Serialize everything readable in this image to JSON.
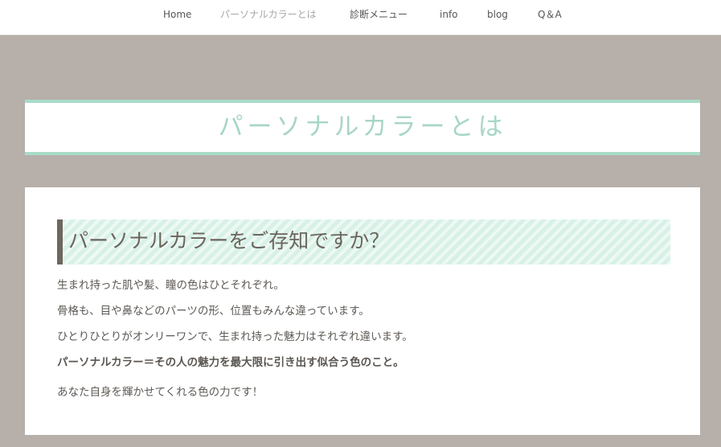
{
  "nav": {
    "items": [
      {
        "label": "Home",
        "active": false
      },
      {
        "label": "パーソナルカラーとは",
        "active": true
      },
      {
        "label": "診断メニュー",
        "active": false
      },
      {
        "label": "info",
        "active": false
      },
      {
        "label": "blog",
        "active": false
      },
      {
        "label": "Q＆A",
        "active": false
      }
    ]
  },
  "page": {
    "title": "パーソナルカラーとは"
  },
  "section": {
    "heading": "パーソナルカラーをご存知ですか？",
    "paragraphs": [
      "生まれ持った肌や髪、瞳の色はひとそれぞれ。",
      "骨格も、目や鼻などのパーツの形、位置もみんな違っています。",
      "ひとりひとりがオンリーワンで、生まれ持った魅力はそれぞれ違います。",
      "パーソナルカラー＝その人の魅力を最大限に引き出す似合う色のこと。",
      "あなた自身を輝かせてくれる色の力です！"
    ]
  },
  "colors": {
    "background": "#b6afaa",
    "accent_mint": "#a8dcc8",
    "title_text": "#a8d6c5",
    "heading_bar": "#6e675e",
    "body_text": "#5e5a55"
  }
}
